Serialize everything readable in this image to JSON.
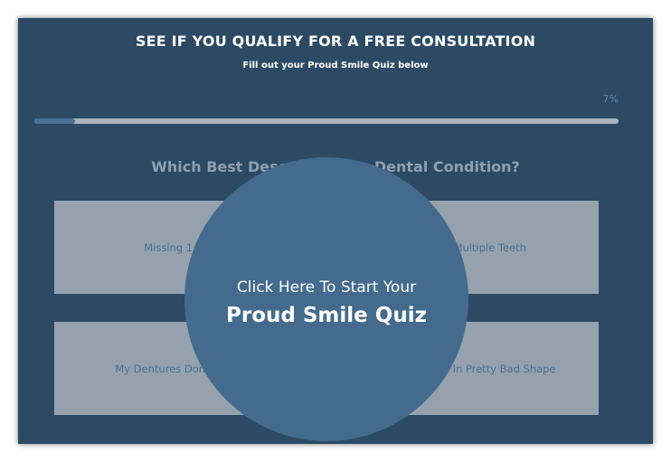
{
  "quiz": {
    "headline": "SEE IF YOU QUALIFY FOR A FREE CONSULTATION",
    "subheadline": "Fill out your Proud Smile Quiz below",
    "progress": {
      "label": "7%",
      "value": 0.07
    },
    "question": "Which Best Describes Your Dental Condition?",
    "answers": [
      "Missing 1 Tooth",
      "Missing Multiple Teeth",
      "My Dentures Don't Fit Well",
      "My Teeth Are In Pretty Bad Shape"
    ]
  },
  "start": {
    "line1": "Click Here To Start Your",
    "line2": "Proud Smile Quiz"
  },
  "colors": {
    "background": "#2c4a64",
    "answer_box": "#95a2ad",
    "circle": "#446b8d",
    "progress_fill": "#4a6f93",
    "progress_track": "#a9b5bf"
  }
}
